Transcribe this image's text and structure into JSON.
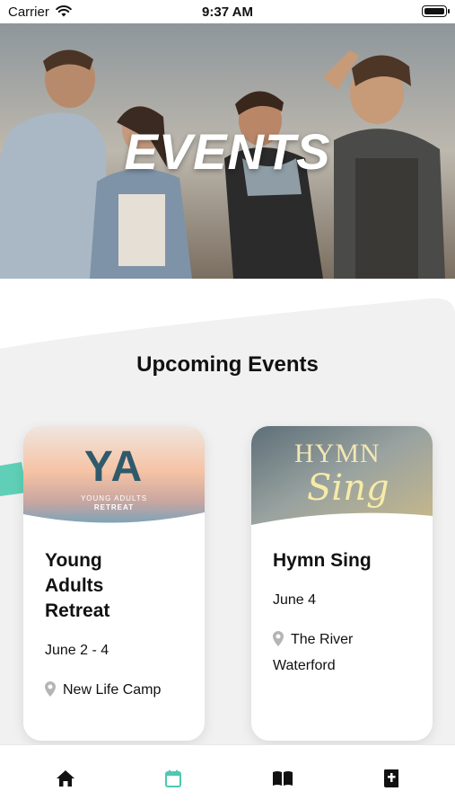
{
  "status_bar": {
    "carrier": "Carrier",
    "time": "9:37 AM"
  },
  "hero": {
    "title": "EVENTS"
  },
  "section": {
    "title": "Upcoming Events"
  },
  "events": [
    {
      "title_line1": "Young",
      "title_line2": "Adults",
      "title_line3": "Retreat",
      "date": "June 2 - 4",
      "location_line1": "New Life Camp",
      "image_text": {
        "letters": "YA",
        "sub1": "YOUNG ADULTS",
        "sub2": "RETREAT"
      }
    },
    {
      "title_line1": "Hymn Sing",
      "date": "June 4",
      "location_line1": "The River",
      "location_line2": "Waterford",
      "image_text": {
        "word1": "HYMN",
        "word2": "Sing"
      }
    }
  ],
  "tab_bar": {
    "items": [
      {
        "icon": "home-icon"
      },
      {
        "icon": "calendar-icon",
        "active": true
      },
      {
        "icon": "open-book-icon"
      },
      {
        "icon": "bible-icon"
      }
    ],
    "active_color": "#4cc9b0",
    "inactive_color": "#111111"
  },
  "colors": {
    "teal_accent": "#5fd0b7",
    "card_shadow": "rgba(0,0,0,0.10)",
    "content_gray": "#f1f1f1"
  }
}
